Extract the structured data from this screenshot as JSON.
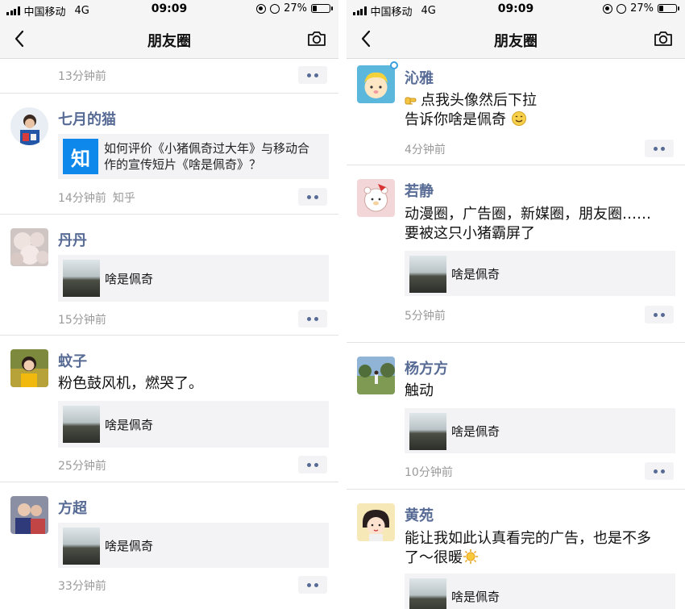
{
  "colors": {
    "name_link": "#576b95",
    "meta_gray": "#9a9a9a",
    "card_bg": "#f3f3f5",
    "zhihu_blue": "#0f88eb",
    "bar_bg": "#f5f5f5"
  },
  "status_bar": {
    "carrier": "中国移动",
    "network": "4G",
    "time": "09:09",
    "battery": "27%",
    "battery_level": 0.27
  },
  "nav": {
    "title": "朋友圈",
    "back_icon": "chevron-left-icon",
    "camera_icon": "camera-icon"
  },
  "left_feed": {
    "top_meta": "13分钟前",
    "posts": [
      {
        "name": "七月的猫",
        "zhihu_logo": "知",
        "card_title": "如何评价《小猪佩奇过大年》与移动合作的宣传短片《啥是佩奇》？",
        "time": "14分钟前",
        "source": "知乎"
      },
      {
        "name": "丹丹",
        "card_title": "啥是佩奇",
        "time": "15分钟前"
      },
      {
        "name": "蚊子",
        "text": "粉色鼓风机，燃哭了。",
        "card_title": "啥是佩奇",
        "time": "25分钟前"
      },
      {
        "name": "方超",
        "card_title": "啥是佩奇",
        "time": "33分钟前"
      }
    ]
  },
  "right_feed": {
    "posts": [
      {
        "name": "沁雅",
        "text_line1": "点我头像然后下拉",
        "text_line2": "告诉你啥是佩奇",
        "time": "4分钟前"
      },
      {
        "name": "若静",
        "text_line1": "动漫圈，广告圈，新媒圈，朋友圈……",
        "text_line2": "要被这只小猪霸屏了",
        "card_title": "啥是佩奇",
        "time": "5分钟前"
      },
      {
        "name": "杨方方",
        "text": "触动",
        "card_title": "啥是佩奇",
        "time": "10分钟前"
      },
      {
        "name": "黄苑",
        "text_line1": "能让我如此认真看完的广告，也是不多",
        "text_line2": "了～很暖",
        "card_title": "啥是佩奇"
      }
    ]
  }
}
